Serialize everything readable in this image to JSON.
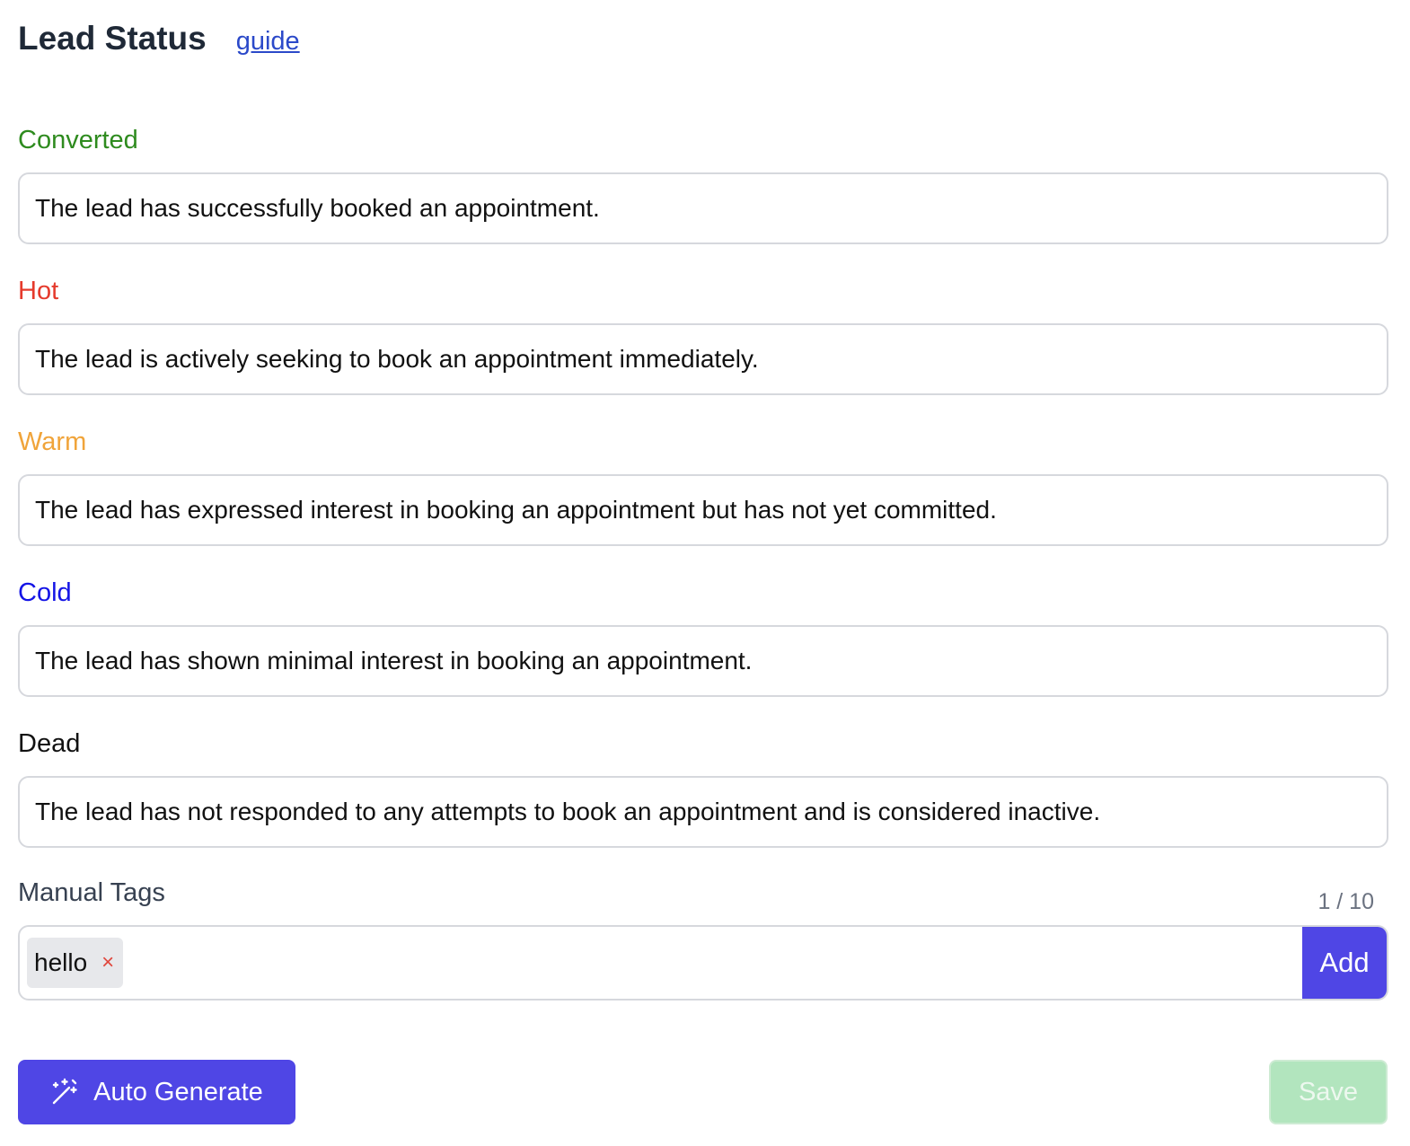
{
  "header": {
    "title": "Lead Status",
    "guide_link": "guide"
  },
  "statuses": [
    {
      "label": "Converted",
      "color": "#2e8b1e",
      "description": "The lead has successfully booked an appointment."
    },
    {
      "label": "Hot",
      "color": "#e53a2c",
      "description": "The lead is actively seeking to book an appointment immediately."
    },
    {
      "label": "Warm",
      "color": "#f0a43a",
      "description": "The lead has expressed interest in booking an appointment but has not yet committed."
    },
    {
      "label": "Cold",
      "color": "#1414e6",
      "description": "The lead has shown minimal interest in booking an appointment."
    },
    {
      "label": "Dead",
      "color": "#111111",
      "description": "The lead has not responded to any attempts to book an appointment and is considered inactive."
    }
  ],
  "manual_tags": {
    "label": "Manual Tags",
    "counter": "1 / 10",
    "tags": [
      "hello"
    ],
    "remove_glyph": "×",
    "add_label": "Add"
  },
  "footer": {
    "auto_generate_label": "Auto Generate",
    "auto_generate_icon": "magic-wand-icon",
    "save_label": "Save"
  },
  "colors": {
    "primary": "#4f46e5",
    "save_disabled": "#b2e5be",
    "link": "#2b49c9"
  }
}
